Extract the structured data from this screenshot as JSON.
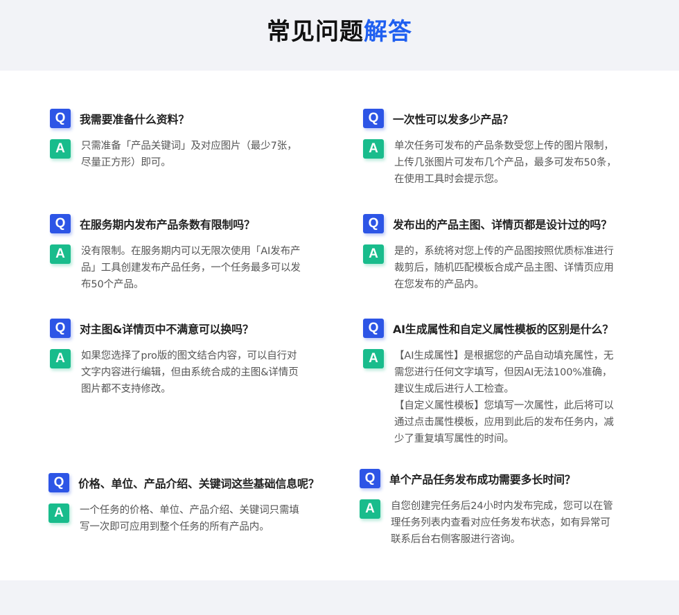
{
  "page": {
    "title_main": "常见问题",
    "title_accent": "解答",
    "q_badge": "Q",
    "a_badge": "A"
  },
  "faq": [
    {
      "question": "我需要准备什么资料？",
      "answer": [
        "只需准备「产品关键词」及对应图片（最少7张，",
        "尽量正方形）即可。"
      ]
    },
    {
      "question": "一次性可以发多少产品？",
      "answer": [
        "单次任务可发布的产品条数受您上传的图片限制，",
        "上传几张图片可发布几个产品，最多可发布50条，",
        "在使用工具时会提示您。"
      ]
    },
    {
      "question": "在服务期内发布产品条数有限制吗？",
      "answer": [
        "没有限制。在服务期内可以无限次使用「AI发布产",
        "品」工具创建发布产品任务，一个任务最多可以发",
        "布50个产品。"
      ]
    },
    {
      "question": "发布出的产品主图、详情页都是设计过的吗？",
      "answer": [
        "是的，系统将对您上传的产品图按照优质标准进行",
        "裁剪后，随机匹配模板合成产品主图、详情页应用",
        "在您发布的产品内。"
      ]
    },
    {
      "question": "对主图&详情页中不满意可以换吗？",
      "answer": [
        "如果您选择了pro版的图文结合内容，可以自行对",
        "文字内容进行编辑，但由系统合成的主图&详情页",
        "图片都不支持修改。"
      ]
    },
    {
      "question": "AI生成属性和自定义属性模板的区别是什么？",
      "answer": [
        "【AI生成属性】是根据您的产品自动填充属性，无",
        "需您进行任何文字填写，但因AI无法100%准确，",
        "建议生成后进行人工检查。",
        "【自定义属性模板】您填写一次属性，此后将可以",
        "通过点击属性模板，应用到此后的发布任务内，减",
        "少了重复填写属性的时间。"
      ]
    },
    {
      "question": "价格、单位、产品介绍、关键词这些基础信息呢？",
      "answer": [
        "一个任务的价格、单位、产品介绍、关键词只需填",
        "写一次即可应用到整个任务的所有产品内。"
      ]
    },
    {
      "question": "单个产品任务发布成功需要多长时间？",
      "answer": [
        "自您创建完任务后24小时内发布完成，您可以在管",
        "理任务列表内查看对应任务发布状态，如有异常可",
        "联系后台右侧客服进行咨询。"
      ]
    }
  ]
}
